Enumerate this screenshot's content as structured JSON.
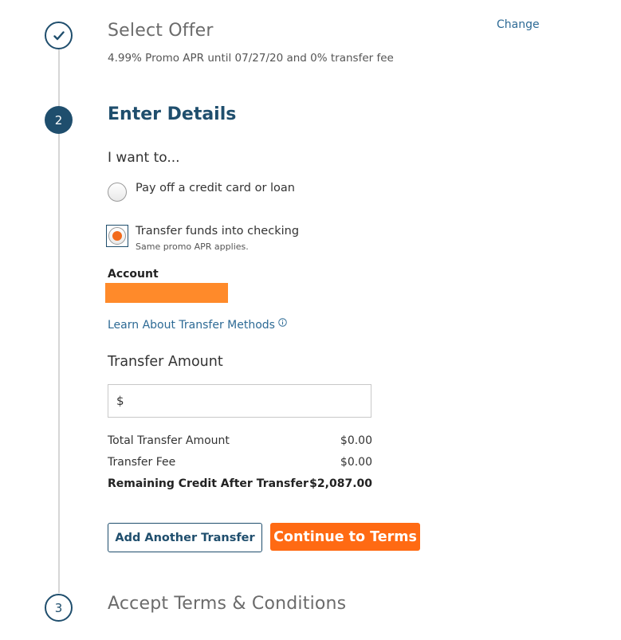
{
  "steps": {
    "select_offer": {
      "title": "Select Offer",
      "description": "4.99% Promo APR until 07/27/20 and 0% transfer fee",
      "change_label": "Change",
      "status_icon": "checkmark-icon"
    },
    "enter_details": {
      "number": "2",
      "title": "Enter Details"
    },
    "accept_terms": {
      "number": "3",
      "title": "Accept Terms & Conditions"
    }
  },
  "form": {
    "prompt": "I want to...",
    "options": [
      {
        "label": "Pay off a credit card or loan",
        "selected": false
      },
      {
        "label": "Transfer funds into checking",
        "sublabel": "Same promo APR applies.",
        "selected": true
      }
    ],
    "account_label": "Account",
    "learn_link": "Learn About Transfer Methods",
    "learn_link_icon": "info-icon",
    "amount_heading": "Transfer Amount",
    "amount_value": "$"
  },
  "summary": {
    "total_label": "Total Transfer Amount",
    "total_value": "$0.00",
    "fee_label": "Transfer Fee",
    "fee_value": "$0.00",
    "remaining_label": "Remaining Credit After Transfer",
    "remaining_value": "$2,087.00"
  },
  "buttons": {
    "add_transfer": "Add Another Transfer",
    "continue": "Continue to Terms"
  },
  "colors": {
    "primary": "#1f4e6d",
    "link": "#2d6a95",
    "accent": "#ff6a13",
    "redaction": "#ff8a2a"
  }
}
